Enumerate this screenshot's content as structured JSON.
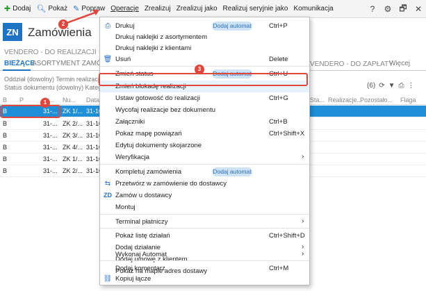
{
  "toolbar": {
    "dodaj": "Dodaj",
    "pokaz": "Pokaż",
    "popraw": "Popraw",
    "operacje": "Operacje",
    "zrealizuj": "Zrealizuj",
    "zrealizuj_jako": "Zrealizuj jako",
    "realizuj_seryjnie": "Realizuj seryjnie jako",
    "komunikacja": "Komunikacja",
    "help": "?",
    "settings": "⚙",
    "restore": "🗗",
    "close": "✕"
  },
  "header": {
    "badge": "ZN",
    "title": "Zamówienia"
  },
  "subtitle": "VENDERO - DO REALIZACJI",
  "subtitle_right": "VENDERO - DO ZAPŁATY",
  "tabs": {
    "biezace": "BIEŻĄCE",
    "asortyment": "ASORTYMENT ZAMÓ",
    "wiecej": "Więcej"
  },
  "filters": {
    "line1": "Oddział (dowolny)   Termin realizacji (",
    "line2": "Status dokumentu (dowolny)   Katego"
  },
  "tools": {
    "count": "(6)"
  },
  "grid": {
    "headers": {
      "b": "B",
      "p": "P",
      "st": "St...",
      "nu": "Nu...",
      "data": "Data...",
      "sta": "Sta...",
      "realizacje": "Realizacje...",
      "pozostalo": "Pozostało...",
      "flaga": "Flaga"
    },
    "rows": [
      {
        "b": "B",
        "st": "31-...",
        "nu": "ZK 1/...",
        "data": "31-10"
      },
      {
        "b": "B",
        "st": "31-...",
        "nu": "ZK 2/...",
        "data": "31-10"
      },
      {
        "b": "B",
        "st": "31-...",
        "nu": "ZK 3/...",
        "data": "31-10"
      },
      {
        "b": "B",
        "st": "31-...",
        "nu": "ZK 4/...",
        "data": "31-10"
      },
      {
        "b": "B",
        "st": "31-...",
        "nu": "ZK 1/...",
        "data": "31-10"
      },
      {
        "b": "B",
        "st": "31-...",
        "nu": "ZK 2/...",
        "data": "31-10"
      }
    ]
  },
  "menu": {
    "badge_label": "Dodaj automat",
    "items": {
      "drukuj": {
        "label": "Drukuj",
        "shortcut": "Ctrl+P"
      },
      "naklejki_asort": {
        "label": "Drukuj naklejki z asortymentem"
      },
      "naklejki_klient": {
        "label": "Drukuj naklejki z klientami"
      },
      "usun": {
        "label": "Usuń",
        "shortcut": "Delete"
      },
      "zmien_status": {
        "label": "Zmień status",
        "shortcut": "Ctrl+U"
      },
      "zmien_blokade": {
        "label": "Zmień blokadę realizacji"
      },
      "ustaw_gotowosc": {
        "label": "Ustaw gotowość do realizacji",
        "shortcut": "Ctrl+G"
      },
      "wycofaj": {
        "label": "Wycofaj realizacje bez dokumentu"
      },
      "zalaczniki": {
        "label": "Załączniki",
        "shortcut": "Ctrl+B"
      },
      "mapa": {
        "label": "Pokaż mapę powiązań",
        "shortcut": "Ctrl+Shift+X"
      },
      "edytuj": {
        "label": "Edytuj dokumenty skojarzone"
      },
      "weryfikacja": {
        "label": "Weryfikacja"
      },
      "kompletuj": {
        "label": "Kompletuj zamówienia"
      },
      "przetworz": {
        "label": "Przetwórz w zamówienie do dostawcy"
      },
      "zamow": {
        "label": "Zamów u dostawcy"
      },
      "montuj": {
        "label": "Montuj"
      },
      "terminal": {
        "label": "Terminal płatniczy"
      },
      "lista_dzialan": {
        "label": "Pokaż listę działań",
        "shortcut": "Ctrl+Shift+D"
      },
      "dodaj_dzialanie": {
        "label": "Dodaj działanie"
      },
      "dodaj_umowe": {
        "label": "Dodaj umowę z klientem"
      },
      "pokaz_adres": {
        "label": "Pokaż na mapie adres dostawy"
      },
      "wykonaj_automat": {
        "label": "Wykonaj Automat"
      },
      "dodaj_komentarz": {
        "label": "Dodaj komentarz",
        "shortcut": "Ctrl+M"
      },
      "kopiuj": {
        "label": "Kopiuj łącze"
      }
    }
  },
  "annotations": {
    "n1": "1",
    "n2": "2",
    "n3": "3"
  },
  "colors": {
    "accent": "#1f73c5",
    "selected_row": "#1f8fd8",
    "annotation": "#e0463c",
    "badge_bg": "#cfe3f6"
  }
}
